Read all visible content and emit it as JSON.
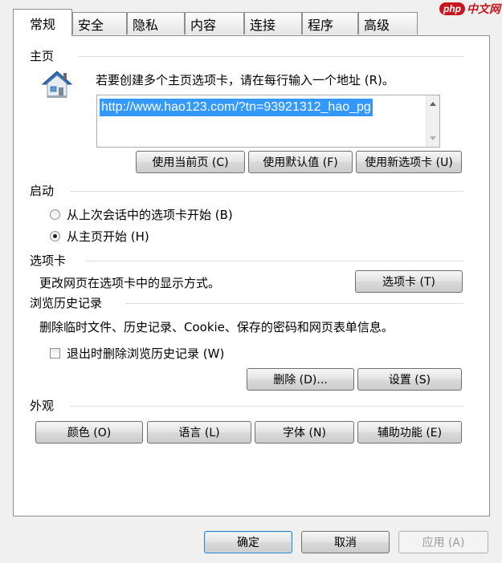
{
  "watermark": {
    "logo": "php",
    "text": "中文网"
  },
  "tabs": [
    "常规",
    "安全",
    "隐私",
    "内容",
    "连接",
    "程序",
    "高级"
  ],
  "homepage": {
    "group_title": "主页",
    "instruction": "若要创建多个主页选项卡，请在每行输入一个地址 (R)。",
    "url": "http://www.hao123.com/?tn=93921312_hao_pg",
    "buttons": [
      "使用当前页 (C)",
      "使用默认值 (F)",
      "使用新选项卡 (U)"
    ]
  },
  "startup": {
    "group_title": "启动",
    "options": [
      "从上次会话中的选项卡开始 (B)",
      "从主页开始 (H)"
    ],
    "selected": 1
  },
  "tabs_section": {
    "group_title": "选项卡",
    "description": "更改网页在选项卡中的显示方式。",
    "button": "选项卡 (T)"
  },
  "history": {
    "group_title": "浏览历史记录",
    "description": "删除临时文件、历史记录、Cookie、保存的密码和网页表单信息。",
    "checkbox_label": "退出时删除浏览历史记录 (W)",
    "checked": false,
    "delete_button": "删除 (D)...",
    "settings_button": "设置 (S)"
  },
  "appearance": {
    "group_title": "外观",
    "buttons": [
      "颜色 (O)",
      "语言 (L)",
      "字体 (N)",
      "辅助功能 (E)"
    ]
  },
  "footer": {
    "ok": "确定",
    "cancel": "取消",
    "apply": "应用 (A)"
  }
}
